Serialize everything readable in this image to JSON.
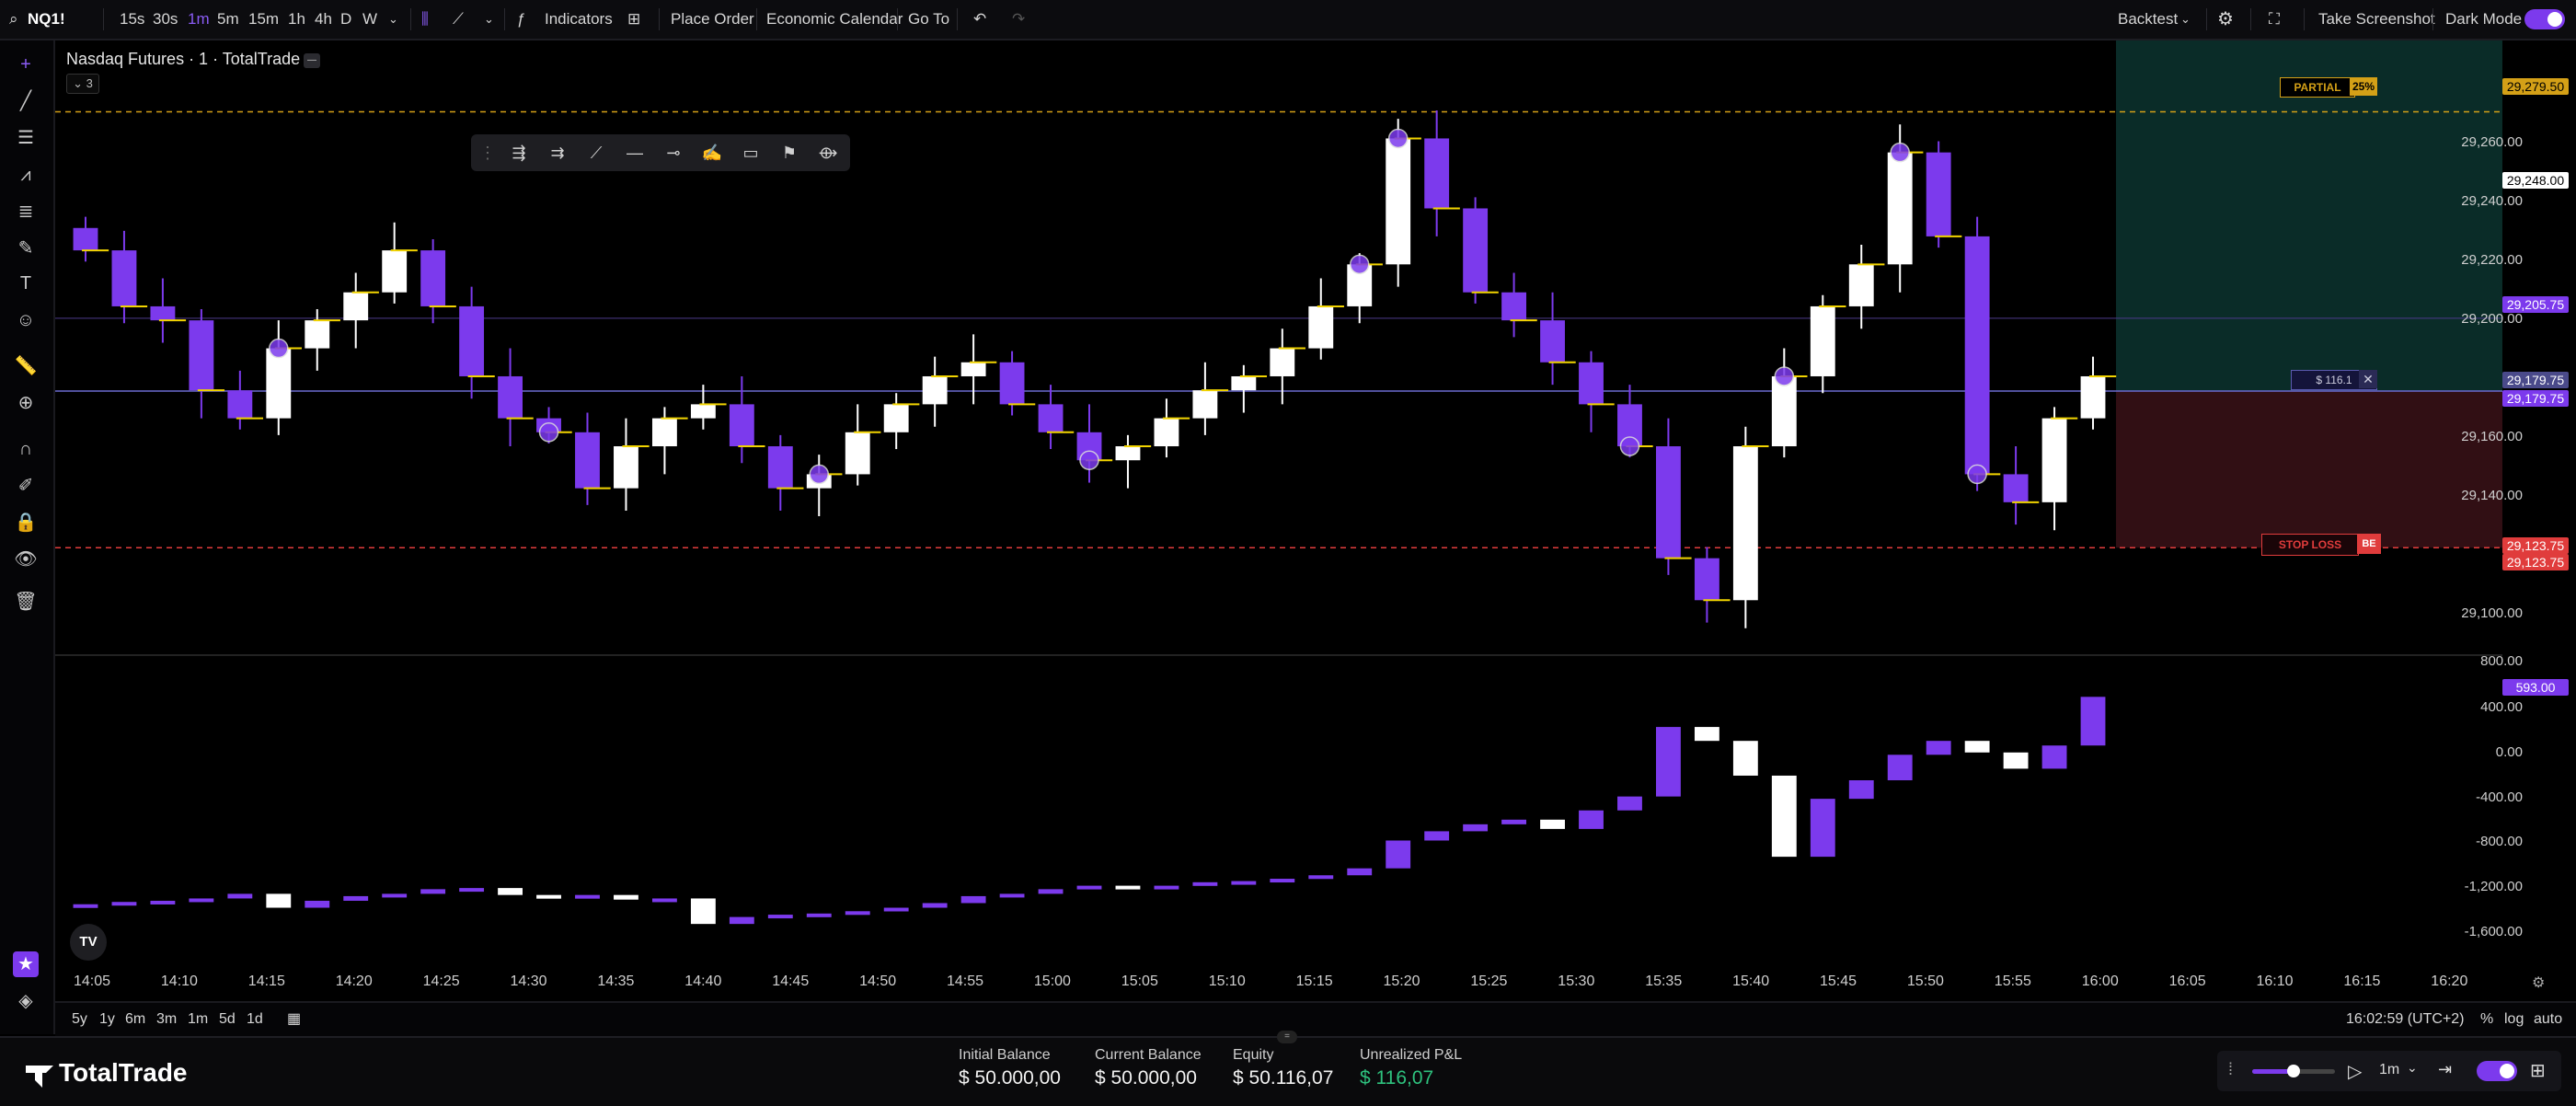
{
  "topbar": {
    "symbol": "NQ1!",
    "timeframes": [
      "15s",
      "30s",
      "1m",
      "5m",
      "15m",
      "1h",
      "4h",
      "D",
      "W"
    ],
    "active_timeframe": "1m",
    "indicators_label": "Indicators",
    "place_order_label": "Place Order",
    "economic_calendar_label": "Economic Calendar",
    "goto_label": "Go To",
    "backtest_label": "Backtest",
    "screenshot_label": "Take Screenshot",
    "darkmode_label": "Dark Mode"
  },
  "chart": {
    "legend_title": "Nasdaq Futures · 1 · TotalTrade",
    "collapse_count": "3",
    "price_axis": [
      "29,260.00",
      "29,240.00",
      "29,220.00",
      "29,200.00",
      "29,160.00",
      "29,140.00",
      "29,100.00"
    ],
    "price_tags": {
      "partial_level": "29,279.50",
      "tp_level": "29,248.00",
      "high_level": "29,205.75",
      "entry1": "29,179.75",
      "entry2": "29,179.75",
      "stop1": "29,123.75",
      "stop2": "29,123.75",
      "indicator_value": "593.00"
    },
    "partial_label": "PARTIAL",
    "partial_pct": "25%",
    "position_pnl": "$ 116.1",
    "stop_label": "STOP LOSS",
    "be_label": "BE",
    "indicator_axis": [
      "800.00",
      "400.00",
      "0.00",
      "-400.00",
      "-800.00",
      "-1,200.00",
      "-1,600.00"
    ],
    "time_axis": [
      "14:05",
      "14:10",
      "14:15",
      "14:20",
      "14:25",
      "14:30",
      "14:35",
      "14:40",
      "14:45",
      "14:50",
      "14:55",
      "15:00",
      "15:05",
      "15:10",
      "15:15",
      "15:20",
      "15:25",
      "15:30",
      "15:35",
      "15:40",
      "15:45",
      "15:50",
      "15:55",
      "16:00",
      "16:05",
      "16:10",
      "16:15",
      "16:20"
    ]
  },
  "bottombar": {
    "ranges": [
      "5y",
      "1y",
      "6m",
      "3m",
      "1m",
      "5d",
      "1d"
    ],
    "clock": "16:02:59 (UTC+2)",
    "pct_label": "%",
    "log_label": "log",
    "auto_label": "auto"
  },
  "footer": {
    "brand": "TotalTrade",
    "initial_balance_label": "Initial Balance",
    "initial_balance": "$ 50.000,00",
    "current_balance_label": "Current Balance",
    "current_balance": "$ 50.000,00",
    "equity_label": "Equity",
    "equity": "$ 50.116,07",
    "unrealized_label": "Unrealized P&L",
    "unrealized": "$ 116,07",
    "speed_label": "1m"
  },
  "colors": {
    "bull": "#ffffff",
    "bear": "#7c3aed",
    "accent": "#8b5cf6",
    "take_profit_zone": "#0d3b35",
    "stop_zone": "#3a1218",
    "partial_line": "#d4a017",
    "stop_line": "#e03c3c",
    "pnl_green": "#2ec27e"
  },
  "chart_data": {
    "type": "candlestick",
    "price_range": [
      29088,
      29305
    ],
    "candles_close_series_approx": [
      29230,
      29210,
      29205,
      29180,
      29170,
      29195,
      29205,
      29215,
      29230,
      29210,
      29185,
      29170,
      29165,
      29145,
      29160,
      29170,
      29175,
      29160,
      29145,
      29150,
      29165,
      29175,
      29185,
      29190,
      29175,
      29165,
      29155,
      29160,
      29170,
      29180,
      29185,
      29195,
      29210,
      29225,
      29270,
      29245,
      29215,
      29205,
      29190,
      29175,
      29160,
      29120,
      29105,
      29160,
      29185,
      29210,
      29225,
      29265,
      29235,
      29150,
      29140,
      29170,
      29185
    ],
    "indicator": {
      "name": "",
      "range": [
        -1800,
        900
      ],
      "last_value": 593
    }
  }
}
